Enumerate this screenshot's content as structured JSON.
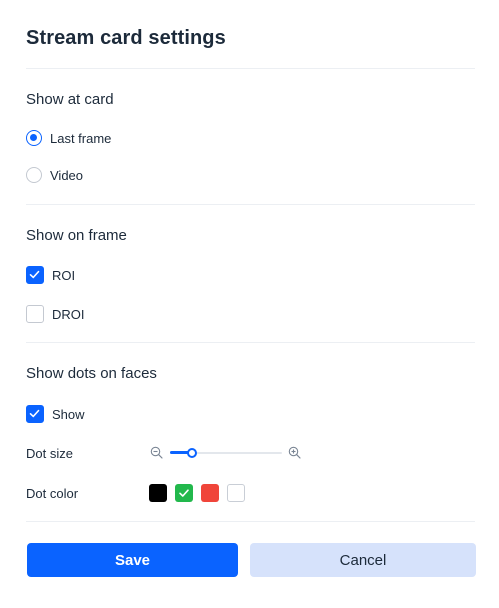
{
  "dialog": {
    "title": "Stream card settings"
  },
  "show_at_card": {
    "title": "Show at card",
    "options": [
      {
        "label": "Last frame",
        "selected": true
      },
      {
        "label": "Video",
        "selected": false
      }
    ]
  },
  "show_on_frame": {
    "title": "Show on frame",
    "options": [
      {
        "label": "ROI",
        "checked": true
      },
      {
        "label": "DROI",
        "checked": false
      }
    ]
  },
  "dots": {
    "title": "Show dots on faces",
    "show_label": "Show",
    "show_checked": true,
    "dot_size_label": "Dot size",
    "dot_size_fraction": 0.2,
    "dot_color_label": "Dot color",
    "colors": [
      {
        "name": "black",
        "hex": "#000000",
        "selected": false
      },
      {
        "name": "green",
        "hex": "#22b84c",
        "selected": true
      },
      {
        "name": "red",
        "hex": "#f0453a",
        "selected": false
      },
      {
        "name": "white",
        "hex": "#ffffff",
        "selected": false
      }
    ]
  },
  "icons": {
    "zoom_out": "zoom-out-icon",
    "zoom_in": "zoom-in-icon",
    "check": "check-icon"
  },
  "accent_color": "#0a63ff",
  "footer": {
    "save_label": "Save",
    "cancel_label": "Cancel"
  }
}
